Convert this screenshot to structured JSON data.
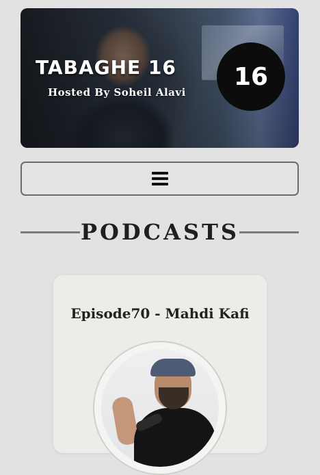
{
  "hero": {
    "title": "TABAGHE 16",
    "subtitle": "Hosted By Soheil Alavi",
    "badge": "16"
  },
  "menu": {
    "icon": "hamburger-menu-icon"
  },
  "section": {
    "title": "PODCASTS"
  },
  "episodes": [
    {
      "title": "Episode70 - Mahdi Kafi"
    }
  ]
}
